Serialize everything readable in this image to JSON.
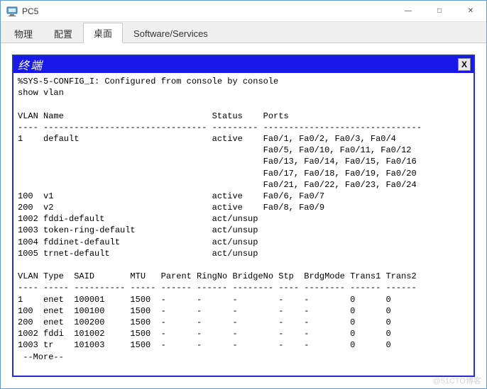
{
  "window": {
    "title": "PC5",
    "min": "—",
    "max": "□",
    "close": "✕"
  },
  "tabs": [
    {
      "label": "物理",
      "active": false
    },
    {
      "label": "配置",
      "active": false
    },
    {
      "label": "桌面",
      "active": true
    },
    {
      "label": "Software/Services",
      "active": false
    }
  ],
  "terminal": {
    "title": "终端",
    "close": "X",
    "lines": [
      "%SYS-5-CONFIG_I: Configured from console by console",
      "show vlan",
      "",
      "VLAN Name                             Status    Ports",
      "---- -------------------------------- --------- -------------------------------",
      "1    default                          active    Fa0/1, Fa0/2, Fa0/3, Fa0/4",
      "                                                Fa0/5, Fa0/10, Fa0/11, Fa0/12",
      "                                                Fa0/13, Fa0/14, Fa0/15, Fa0/16",
      "                                                Fa0/17, Fa0/18, Fa0/19, Fa0/20",
      "                                                Fa0/21, Fa0/22, Fa0/23, Fa0/24",
      "100  v1                               active    Fa0/6, Fa0/7",
      "200  v2                               active    Fa0/8, Fa0/9",
      "1002 fddi-default                     act/unsup",
      "1003 token-ring-default               act/unsup",
      "1004 fddinet-default                  act/unsup",
      "1005 trnet-default                    act/unsup",
      "",
      "VLAN Type  SAID       MTU   Parent RingNo BridgeNo Stp  BrdgMode Trans1 Trans2",
      "---- ----- ---------- ----- ------ ------ -------- ---- -------- ------ ------",
      "1    enet  100001     1500  -      -      -        -    -        0      0",
      "100  enet  100100     1500  -      -      -        -    -        0      0",
      "200  enet  100200     1500  -      -      -        -    -        0      0",
      "1002 fddi  101002     1500  -      -      -        -    -        0      0",
      "1003 tr    101003     1500  -      -      -        -    -        0      0",
      " --More--"
    ]
  },
  "watermark": "@51CTO博客"
}
